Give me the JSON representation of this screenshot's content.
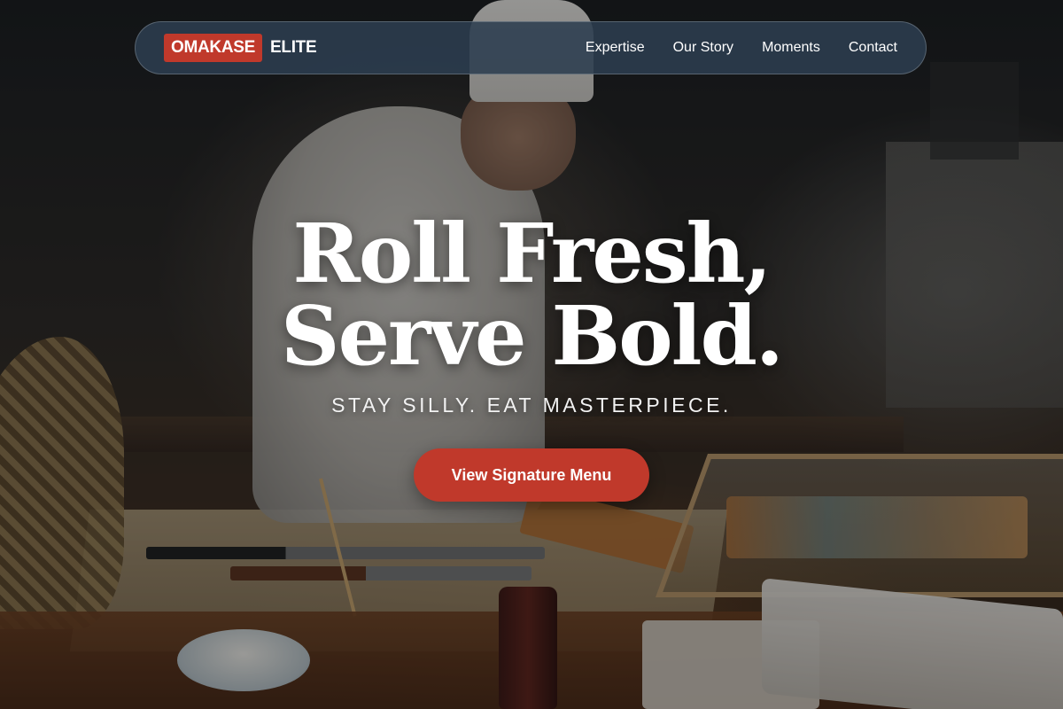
{
  "brand": {
    "name_main": "OMAKASE",
    "name_sub": "ELITE",
    "accent_color": "#c0392b"
  },
  "nav": {
    "links": [
      {
        "label": "Expertise"
      },
      {
        "label": "Our Story"
      },
      {
        "label": "Moments"
      },
      {
        "label": "Contact"
      }
    ],
    "background_color": "#2c3e50"
  },
  "hero": {
    "headline_line1": "Roll Fresh,",
    "headline_line2": "Serve Bold.",
    "tagline": "STAY SILLY. EAT MASTERPIECE.",
    "cta_label": "View Signature Menu"
  }
}
